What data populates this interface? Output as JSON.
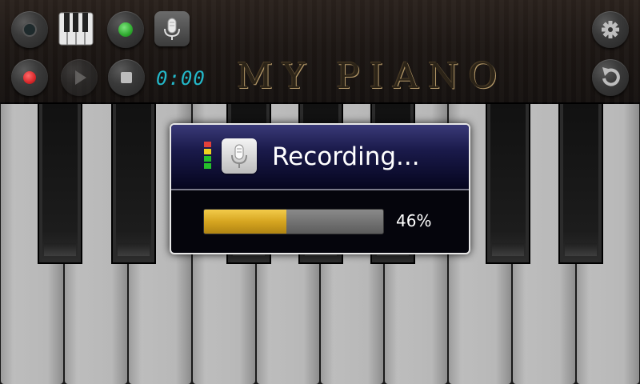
{
  "header": {
    "title": "MY PIANO",
    "timer": "0:00"
  },
  "toolbar": {
    "row1": [
      {
        "name": "ring-button",
        "icon": "dark-dot-icon"
      },
      {
        "name": "keyboard-toggle-button",
        "icon": "piano-keys-icon"
      },
      {
        "name": "green-light-button",
        "icon": "green-dot-icon"
      },
      {
        "name": "microphone-button",
        "icon": "microphone-icon"
      },
      {
        "name": "settings-button",
        "icon": "gear-icon"
      }
    ],
    "row2": [
      {
        "name": "record-button",
        "icon": "record-icon"
      },
      {
        "name": "play-button",
        "icon": "play-icon"
      },
      {
        "name": "stop-button",
        "icon": "stop-icon"
      },
      {
        "name": "reload-button",
        "icon": "refresh-icon"
      }
    ]
  },
  "dialog": {
    "title": "Recording...",
    "progress_percent": 46,
    "progress_label": "46%",
    "level_colors": [
      "#e2403a",
      "#f0d020",
      "#25c02a",
      "#25c02a"
    ]
  },
  "keyboard": {
    "white_keys": 10,
    "black_keys": 7
  },
  "colors": {
    "timer": "#23b7c8",
    "record": "#d8272a",
    "green_light": "#2faa2f",
    "progress": "#d6a520"
  }
}
